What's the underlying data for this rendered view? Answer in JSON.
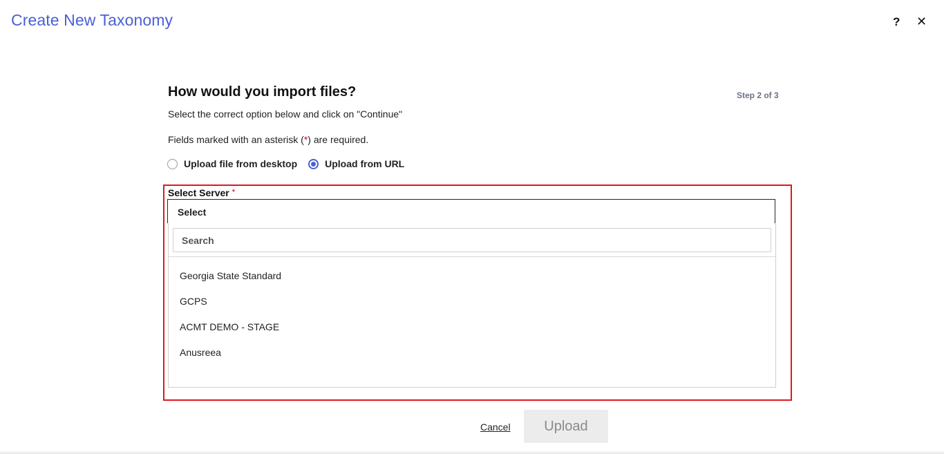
{
  "dialog": {
    "title": "Create New Taxonomy",
    "help_icon": "?",
    "close_icon": "✕"
  },
  "form": {
    "heading": "How would you import files?",
    "step": "Step 2 of 3",
    "instruction": "Select the correct option below and click on \"Continue\"",
    "required_note_prefix": "Fields marked with an asterisk (",
    "required_note_asterisk": "*",
    "required_note_suffix": ") are required.",
    "import_options": [
      {
        "label": "Upload file from desktop",
        "checked": false
      },
      {
        "label": "Upload from URL",
        "checked": true
      }
    ]
  },
  "server_select": {
    "label": "Select Server",
    "required_marker": "*",
    "selected_value": "Select",
    "search_placeholder": "Search",
    "options": [
      "Georgia State Standard",
      "GCPS",
      "ACMT DEMO - STAGE",
      "Anusreea"
    ]
  },
  "actions": {
    "cancel_label": "Cancel",
    "upload_label": "Upload"
  },
  "colors": {
    "accent": "#4a5fd4",
    "highlight_border": "#e0161e",
    "required": "#d0021b",
    "disabled_button_bg": "#ececec"
  }
}
